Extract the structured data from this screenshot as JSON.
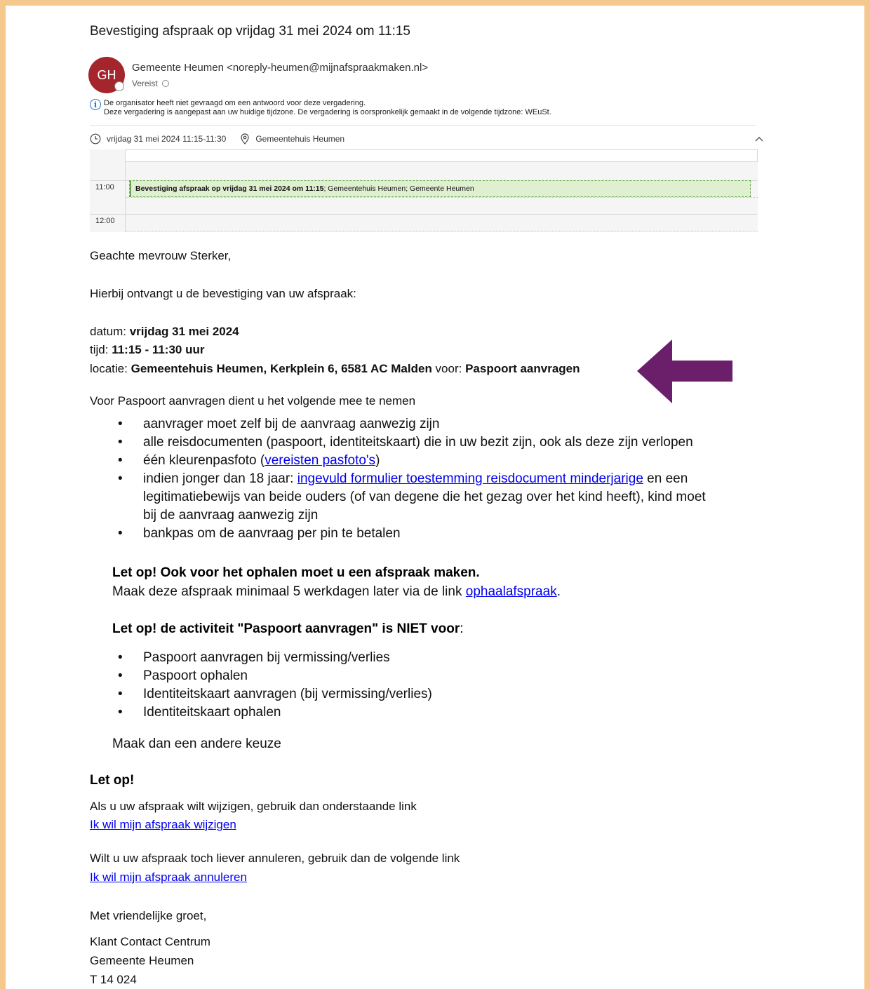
{
  "email": {
    "subject": "Bevestiging afspraak op vrijdag 31 mei 2024 om 11:15",
    "avatar_initials": "GH",
    "sender": "Gemeente Heumen <noreply-heumen@mijnafspraakmaken.nl>",
    "required_label": "Vereist",
    "info_line1": "De organisator heeft niet gevraagd om een antwoord voor deze vergadering.",
    "info_line2": "Deze vergadering is aangepast aan uw huidige tijdzone. De vergadering is oorspronkelijk gemaakt in de volgende tijdzone: WEuSt.",
    "when": "vrijdag 31 mei 2024 11:15-11:30",
    "where": "Gemeentehuis Heumen"
  },
  "calendar": {
    "time_11": "11:00",
    "time_12": "12:00",
    "event_bold": "Bevestiging afspraak op vrijdag 31 mei 2024 om 11:15",
    "event_rest": "; Gemeentehuis Heumen; Gemeente Heumen"
  },
  "body": {
    "greeting": "Geachte mevrouw Sterker,",
    "intro": "Hierbij ontvangt u de bevestiging van uw afspraak:",
    "date_label": "datum: ",
    "date_value": "vrijdag 31 mei 2024",
    "time_label": "tijd: ",
    "time_value": "11:15 - 11:30 uur",
    "location_label": "locatie: ",
    "location_value": "Gemeentehuis Heumen, Kerkplein 6, 6581 AC Malden",
    "for_label": " voor: ",
    "for_value": "Paspoort aanvragen",
    "bring_intro": "Voor Paspoort aanvragen dient u het volgende mee te nemen",
    "bring_1": "aanvrager moet zelf bij de aanvraag aanwezig zijn",
    "bring_2": "alle reisdocumenten (paspoort, identiteitskaart) die in uw bezit zijn, ook als deze zijn verlopen",
    "bring_3_pre": "één kleurenpasfoto (",
    "bring_3_link": "vereisten pasfoto's",
    "bring_3_post": ")",
    "bring_4_pre": "indien jonger dan 18 jaar: ",
    "bring_4_link": "ingevuld formulier toestemming reisdocument minderjarige",
    "bring_4_post1": " en een",
    "bring_4_line2": "legitimatiebewijs van beide ouders (of van degene die het gezag over het kind heeft), kind moet",
    "bring_4_line3": "bij de aanvraag aanwezig zijn",
    "bring_5": "bankpas om de aanvraag per pin te betalen",
    "note1_title": "Let op!  Ook voor het ophalen moet u een afspraak maken.",
    "note1_text_pre": "Maak deze afspraak minimaal 5 werkdagen later via de link ",
    "note1_link": "ophaalafspraak",
    "note1_text_post": ".",
    "note2_title": "Let op! de activiteit \"Paspoort aanvragen\" is NIET voor",
    "note2_colon": ":",
    "not_1": "Paspoort aanvragen bij vermissing/verlies",
    "not_2": "Paspoort ophalen",
    "not_3": "Identiteitskaart aanvragen (bij vermissing/verlies)",
    "not_4": "Identiteitskaart ophalen",
    "other_choice": "Maak dan een andere keuze",
    "attention": "Let op!",
    "change_text": "Als u uw afspraak wilt wijzigen, gebruik dan onderstaande link",
    "change_link": "Ik wil mijn afspraak wijzigen",
    "cancel_text": "Wilt u uw afspraak toch liever annuleren, gebruik dan de volgende link",
    "cancel_link": "Ik wil mijn afspraak annuleren",
    "regards": "Met vriendelijke groet,",
    "sig_1": "Klant Contact Centrum",
    "sig_2": "Gemeente Heumen",
    "sig_3": "T 14 024"
  },
  "colors": {
    "frame": "#f5c88e",
    "avatar": "#a4262c",
    "arrow": "#6b1f6b",
    "link": "#0000ee",
    "event_bg": "#dff0d0"
  }
}
